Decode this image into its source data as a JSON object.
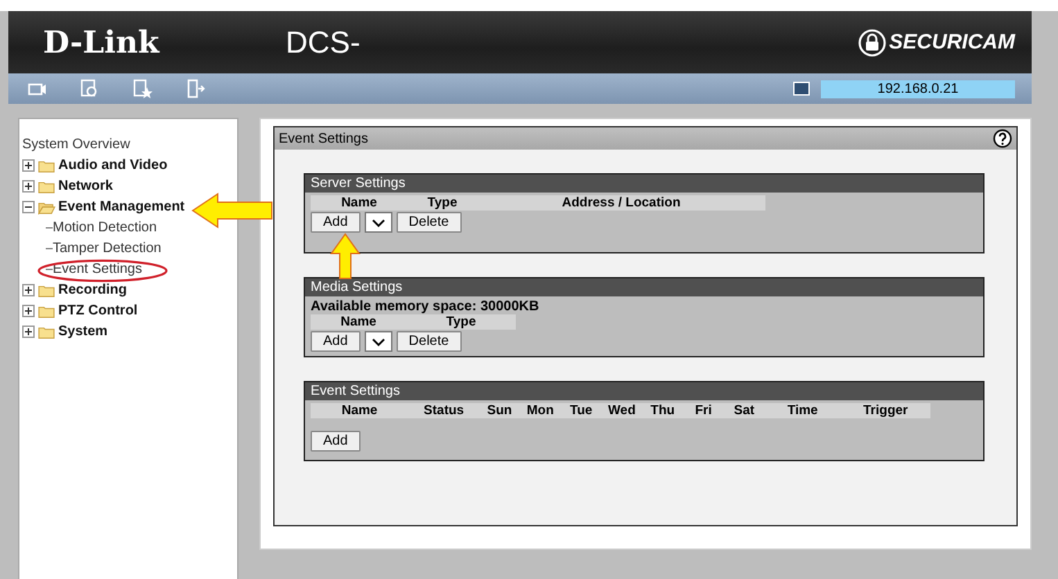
{
  "header": {
    "logo": "D-Link",
    "model": "DCS-",
    "brand": "SECURICAM"
  },
  "toolbar": {
    "ip_address": "192.168.0.21"
  },
  "sidebar": {
    "title": "System Overview",
    "items": [
      {
        "label": "Audio and Video",
        "expanded": false
      },
      {
        "label": "Network",
        "expanded": false
      },
      {
        "label": "Event Management",
        "expanded": true,
        "children": [
          {
            "label": "Motion Detection"
          },
          {
            "label": "Tamper Detection"
          },
          {
            "label": "Event Settings"
          }
        ]
      },
      {
        "label": "Recording",
        "expanded": false
      },
      {
        "label": "PTZ Control",
        "expanded": false
      },
      {
        "label": "System",
        "expanded": false
      }
    ]
  },
  "panel": {
    "title": "Event Settings",
    "sections": [
      {
        "title": "Server Settings",
        "columns": [
          "Name",
          "Type",
          "Address / Location"
        ],
        "controls": [
          {
            "kind": "button",
            "label": "Add"
          },
          {
            "kind": "select"
          },
          {
            "kind": "button",
            "label": "Delete"
          }
        ]
      },
      {
        "title": "Media Settings",
        "note": "Available memory space: 30000KB",
        "columns": [
          "Name",
          "Type"
        ],
        "controls": [
          {
            "kind": "button",
            "label": "Add"
          },
          {
            "kind": "select"
          },
          {
            "kind": "button",
            "label": "Delete"
          }
        ]
      },
      {
        "title": "Event Settings",
        "columns": [
          "Name",
          "Status",
          "Sun",
          "Mon",
          "Tue",
          "Wed",
          "Thu",
          "Fri",
          "Sat",
          "Time",
          "Trigger"
        ],
        "controls": [
          {
            "kind": "button",
            "label": "Add"
          }
        ]
      }
    ]
  }
}
